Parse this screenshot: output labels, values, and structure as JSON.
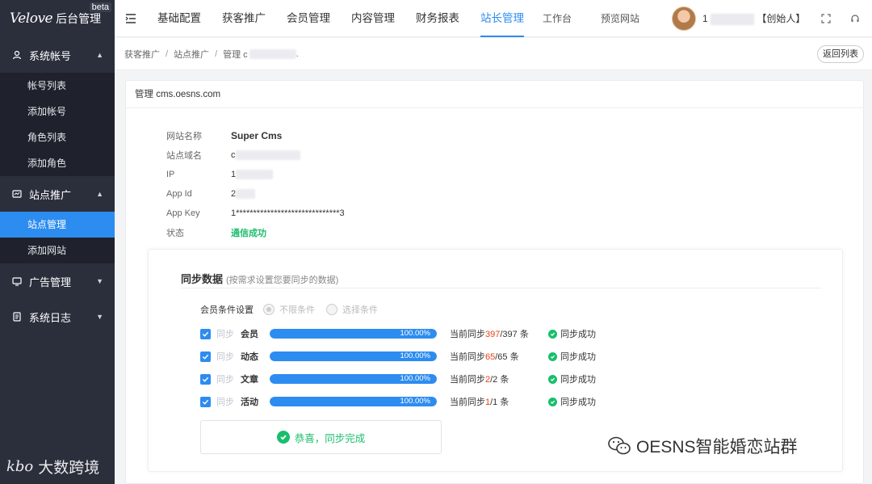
{
  "sidebar": {
    "brand_logo": "Velove",
    "brand_title": "后台管理",
    "beta": "beta",
    "groups": [
      {
        "label": "系统帐号",
        "icon": "user-icon",
        "expanded": true,
        "items": [
          "帐号列表",
          "添加帐号",
          "角色列表",
          "添加角色"
        ]
      },
      {
        "label": "站点推广",
        "icon": "promo-icon",
        "expanded": true,
        "items": [
          "站点管理",
          "添加网站"
        ],
        "active_item": "站点管理"
      },
      {
        "label": "广告管理",
        "icon": "ad-icon",
        "expanded": false
      },
      {
        "label": "系统日志",
        "icon": "log-icon",
        "expanded": false
      }
    ],
    "watermark": "大数跨境"
  },
  "topbar": {
    "nav": [
      "基础配置",
      "获客推广",
      "会员管理",
      "内容管理",
      "财务报表",
      "站长管理"
    ],
    "active": "站长管理",
    "workspace": "工作台",
    "preview": "预览网站",
    "user_prefix": "1",
    "user_role": "【创始人】"
  },
  "breadcrumb": {
    "items": [
      "获客推广",
      "站点推广",
      "管理 c"
    ],
    "tail": ".",
    "back_label": "返回列表"
  },
  "card": {
    "title": "管理 cms.oesns.com",
    "info": [
      {
        "key": "网站名称",
        "value": "Super Cms"
      },
      {
        "key": "站点域名",
        "value": "c"
      },
      {
        "key": "IP",
        "value": "1"
      },
      {
        "key": "App Id",
        "value": "2"
      },
      {
        "key": "App Key",
        "value": "1******************************3"
      },
      {
        "key": "状态",
        "value": "通信成功"
      }
    ]
  },
  "sync": {
    "title": "同步数据",
    "hint": "(按需求设置您要同步的数据)",
    "condition_label": "会员条件设置",
    "options": [
      "不限条件",
      "选择条件"
    ],
    "sync_word": "同步",
    "items": [
      {
        "name": "会员",
        "progress": 1.0,
        "percent_text": "100.00%",
        "count_prefix": "当前同步",
        "current": "397",
        "total": "/397 条",
        "status": "同步成功"
      },
      {
        "name": "动态",
        "progress": 1.0,
        "percent_text": "100.00%",
        "count_prefix": "当前同步",
        "current": "65",
        "total": "/65 条",
        "status": "同步成功"
      },
      {
        "name": "文章",
        "progress": 1.0,
        "percent_text": "100.00%",
        "count_prefix": "当前同步",
        "current": "2",
        "total": "/2 条",
        "status": "同步成功"
      },
      {
        "name": "活动",
        "progress": 1.0,
        "percent_text": "100.00%",
        "count_prefix": "当前同步",
        "current": "1",
        "total": "/1 条",
        "status": "同步成功"
      }
    ],
    "done_text": "恭喜，同步完成"
  },
  "watermark_right": "OESNS智能婚恋站群",
  "colors": {
    "primary": "#2d8cf0",
    "success": "#19be6b",
    "danger": "#ed4014",
    "sidebar": "#2b2f3c"
  }
}
